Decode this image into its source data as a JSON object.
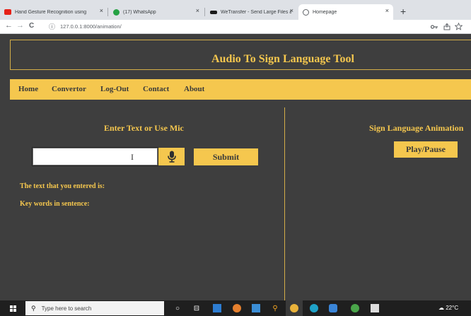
{
  "browser": {
    "tabs": [
      {
        "title": "Hand Gesture Recognition using",
        "favicon_color": "#e62117",
        "icon": "youtube-icon",
        "close": "×"
      },
      {
        "title": "(17) WhatsApp",
        "favicon_color": "#25a244",
        "icon": "whatsapp-icon",
        "close": "×"
      },
      {
        "title": "WeTransfer - Send Large Files &",
        "favicon_color": "#1b1b1b",
        "icon": "wetransfer-icon",
        "close": "×"
      },
      {
        "title": "Homepage",
        "favicon_color": "#5f6368",
        "icon": "globe-icon",
        "close": "×",
        "active": true
      }
    ],
    "new_tab": "+",
    "back": "←",
    "forward": "→",
    "reload": "C",
    "info": "ⓘ",
    "url": "127.0.0.1:8000/animation/",
    "toolbar_icons": [
      "key-icon",
      "share-icon",
      "star-icon"
    ]
  },
  "header": {
    "title": "Audio To Sign Language Tool"
  },
  "nav": {
    "items": [
      "Home",
      "Convertor",
      "Log-Out",
      "Contact",
      "About"
    ]
  },
  "left_panel": {
    "heading": "Enter Text or Use Mic",
    "input_value": "",
    "submit_label": "Submit",
    "entered_text_label": "The text that you entered is:",
    "keywords_label": "Key words in sentence:"
  },
  "right_panel": {
    "heading": "Sign Language Animation",
    "play_pause_label": "Play/Pause"
  },
  "taskbar": {
    "search_placeholder": "Type here to search",
    "weather": "22°C"
  },
  "colors": {
    "accent": "#f5c74e",
    "background": "#3e3e3e",
    "nav_text": "#3a3a3a"
  }
}
